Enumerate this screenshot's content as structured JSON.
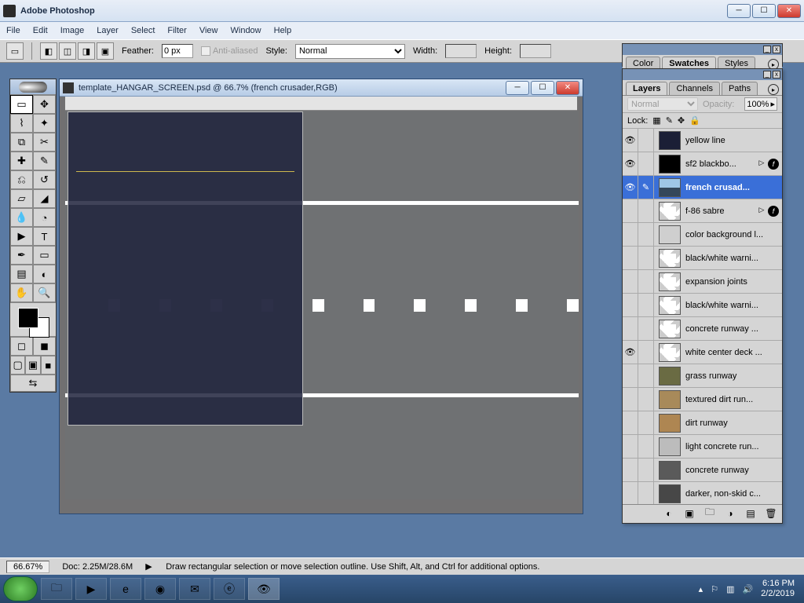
{
  "app": {
    "title": "Adobe Photoshop"
  },
  "menu": {
    "items": [
      "File",
      "Edit",
      "Image",
      "Layer",
      "Select",
      "Filter",
      "View",
      "Window",
      "Help"
    ]
  },
  "options": {
    "feather_label": "Feather:",
    "feather_value": "0 px",
    "antialias": "Anti-aliased",
    "style_label": "Style:",
    "style_value": "Normal",
    "width_label": "Width:",
    "height_label": "Height:"
  },
  "doc": {
    "title": "template_HANGAR_SCREEN.psd @ 66.7% (french crusader,RGB)"
  },
  "status": {
    "zoom": "66.67%",
    "docinfo": "Doc: 2.25M/28.6M",
    "hint": "Draw rectangular selection or move selection outline.  Use Shift, Alt, and Ctrl for additional options."
  },
  "palettes": {
    "top": {
      "tabs": [
        "Color",
        "Swatches",
        "Styles"
      ],
      "active": "Swatches"
    },
    "layers": {
      "tabs": [
        "Layers",
        "Channels",
        "Paths"
      ],
      "active": "Layers",
      "blend": "Normal",
      "opacity_label": "Opacity:",
      "opacity_value": "100%",
      "lock_label": "Lock:",
      "items": [
        {
          "name": "yellow line",
          "visible": true,
          "link": false,
          "thumb": "#1b1f36",
          "extras": false,
          "selected": false
        },
        {
          "name": "sf2 blackbo...",
          "visible": true,
          "link": false,
          "thumb": "#000",
          "extras": true,
          "selected": false
        },
        {
          "name": "french crusad...",
          "visible": true,
          "link": true,
          "thumb": "#7bb0da",
          "thumbimg": true,
          "extras": false,
          "selected": true
        },
        {
          "name": "f-86 sabre",
          "visible": false,
          "link": false,
          "thumb": "checker",
          "extras": true,
          "selected": false
        },
        {
          "name": "color background l...",
          "visible": false,
          "link": false,
          "thumb": "#cfcfcf",
          "extras": false,
          "selected": false
        },
        {
          "name": "black/white warni...",
          "visible": false,
          "link": false,
          "thumb": "checker",
          "extras": false,
          "selected": false
        },
        {
          "name": "expansion joints",
          "visible": false,
          "link": false,
          "thumb": "checker",
          "extras": false,
          "selected": false
        },
        {
          "name": "black/white warni...",
          "visible": false,
          "link": false,
          "thumb": "checker",
          "extras": false,
          "selected": false
        },
        {
          "name": "concrete runway ...",
          "visible": false,
          "link": false,
          "thumb": "checker",
          "extras": false,
          "selected": false
        },
        {
          "name": "white center deck ...",
          "visible": true,
          "link": false,
          "thumb": "checker",
          "extras": false,
          "selected": false
        },
        {
          "name": "grass runway",
          "visible": false,
          "link": false,
          "thumb": "#6a6b43",
          "extras": false,
          "selected": false
        },
        {
          "name": "textured dirt run...",
          "visible": false,
          "link": false,
          "thumb": "#a88a5a",
          "extras": false,
          "selected": false
        },
        {
          "name": "dirt runway",
          "visible": false,
          "link": false,
          "thumb": "#ae8652",
          "extras": false,
          "selected": false
        },
        {
          "name": "light concrete run...",
          "visible": false,
          "link": false,
          "thumb": "#bcbcbc",
          "extras": false,
          "selected": false
        },
        {
          "name": "concrete runway",
          "visible": false,
          "link": false,
          "thumb": "#5a5a5a",
          "extras": false,
          "selected": false
        },
        {
          "name": "darker, non-skid c...",
          "visible": false,
          "link": false,
          "thumb": "#474747",
          "extras": false,
          "selected": false
        }
      ]
    }
  },
  "system": {
    "time": "6:16 PM",
    "date": "2/2/2019"
  }
}
